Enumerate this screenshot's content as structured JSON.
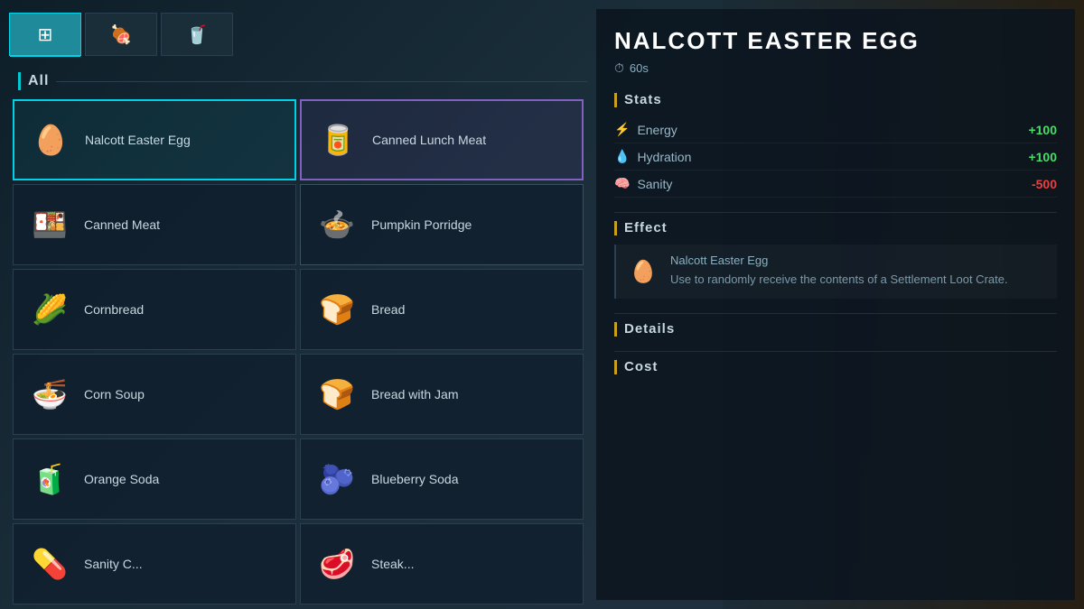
{
  "tabs": [
    {
      "label": "⊞",
      "id": "grid",
      "active": true,
      "icon": "grid-icon"
    },
    {
      "label": "🍖",
      "id": "meat",
      "active": false,
      "icon": "meat-icon"
    },
    {
      "label": "🥤",
      "id": "drink",
      "active": false,
      "icon": "drink-icon"
    }
  ],
  "section": {
    "title": "All"
  },
  "items": [
    {
      "id": "nalcott-easter-egg",
      "name": "Nalcott Easter Egg",
      "icon": "🥚",
      "selected": "cyan",
      "col": 0
    },
    {
      "id": "canned-lunch-meat",
      "name": "Canned Lunch Meat",
      "icon": "🥫",
      "selected": "purple",
      "col": 1
    },
    {
      "id": "canned-meat",
      "name": "Canned Meat",
      "icon": "🍱",
      "selected": "none",
      "col": 0
    },
    {
      "id": "pumpkin-porridge",
      "name": "Pumpkin Porridge",
      "icon": "🍲",
      "selected": "dark",
      "col": 1
    },
    {
      "id": "cornbread",
      "name": "Cornbread",
      "icon": "🌽",
      "selected": "none",
      "col": 0
    },
    {
      "id": "bread",
      "name": "Bread",
      "icon": "🍞",
      "selected": "none",
      "col": 1
    },
    {
      "id": "corn-soup",
      "name": "Corn Soup",
      "icon": "🍜",
      "selected": "none",
      "col": 0
    },
    {
      "id": "bread-with-jam",
      "name": "Bread with Jam",
      "icon": "🍞",
      "selected": "none",
      "col": 1
    },
    {
      "id": "orange-soda",
      "name": "Orange Soda",
      "icon": "🧃",
      "selected": "none",
      "col": 0
    },
    {
      "id": "blueberry-soda",
      "name": "Blueberry Soda",
      "icon": "🫐",
      "selected": "none",
      "col": 1
    },
    {
      "id": "sanity-c",
      "name": "Sanity C...",
      "icon": "💊",
      "selected": "none",
      "col": 0
    },
    {
      "id": "steak",
      "name": "Steak...",
      "icon": "🥩",
      "selected": "none",
      "col": 1
    }
  ],
  "detail": {
    "title": "NALCOTT EASTER EGG",
    "time": "60s",
    "time_label": "60s",
    "sections": {
      "stats": {
        "title": "Stats",
        "rows": [
          {
            "label": "Energy",
            "icon": "⚡",
            "value": "+100",
            "type": "positive"
          },
          {
            "label": "Hydration",
            "icon": "💧",
            "value": "+100",
            "type": "positive"
          },
          {
            "label": "Sanity",
            "icon": "🧠",
            "value": "-500",
            "type": "negative"
          }
        ]
      },
      "effect": {
        "title": "Effect",
        "icon": "🥚",
        "name": "Nalcott Easter Egg",
        "description": "Use to randomly receive the contents of a Settlement Loot Crate."
      },
      "details": {
        "title": "Details"
      },
      "cost": {
        "title": "Cost"
      }
    }
  }
}
